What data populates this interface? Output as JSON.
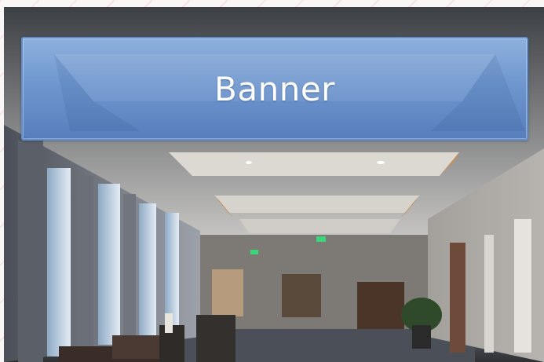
{
  "banner": {
    "label": "Banner"
  },
  "colors": {
    "banner_top": "#96bef0",
    "banner_bottom": "#507cc2",
    "banner_border": "#5f8fcf",
    "page_background": "#fbf6f6",
    "exit_sign": "#3bd67a"
  },
  "photo": {
    "subject": "hotel-corridor-photo"
  }
}
